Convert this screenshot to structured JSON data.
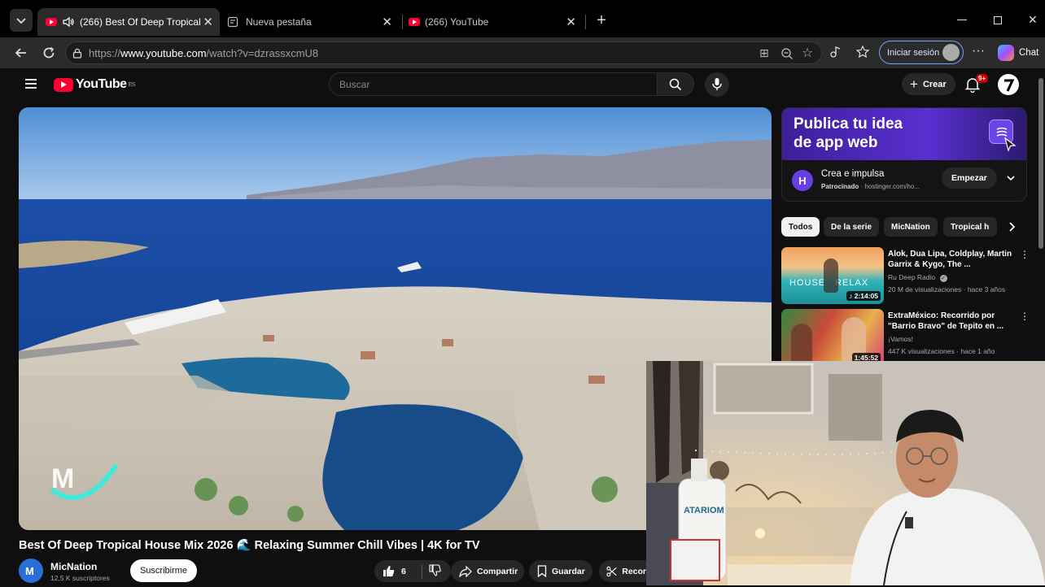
{
  "browser": {
    "tabs": [
      {
        "label": "(266) Best Of Deep Tropical H",
        "active": true
      },
      {
        "label": "Nueva pestaña",
        "active": false
      },
      {
        "label": "(266) YouTube",
        "active": false
      }
    ],
    "url_prefix": "https://",
    "url_host": "www.youtube.com",
    "url_path": "/watch?v=dzrassxcmU8",
    "signin_label": "Iniciar sesión",
    "chat_label": "Chat",
    "colors": {
      "tab_bar": "#000000",
      "toolbar": "#2b2b2b",
      "accent": "#7a9cff"
    }
  },
  "youtube": {
    "logo_text": "YouTube",
    "logo_region": "ES",
    "search_placeholder": "Buscar",
    "create_label": "Crear",
    "notifications_count": "9+",
    "colors": {
      "brand": "#ff0033",
      "background": "#0f0f0f"
    }
  },
  "video": {
    "title": "Best Of Deep Tropical House Mix 2026 🌊 Relaxing Summer Chill Vibes | 4K for TV",
    "channel_name": "MicNation",
    "subscribers": "12,5 K suscriptores",
    "subscribe_label": "Suscribirme",
    "likes": "6",
    "share_label": "Compartir",
    "save_label": "Guardar",
    "clip_label": "Recor"
  },
  "sidebar": {
    "ad": {
      "headline_line1": "Publica tu idea",
      "headline_line2": "de app web",
      "advertiser_initial": "H",
      "title": "Crea e impulsa",
      "sponsored_label": "Patrocinado",
      "domain": "hostinger.com/ho...",
      "cta_label": "Empezar"
    },
    "chips": [
      "Todos",
      "De la serie",
      "MicNation",
      "Tropical h"
    ],
    "recommendations": [
      {
        "title": "Alok, Dua Lipa, Coldplay, Martin Garrix & Kygo, The ...",
        "channel": "Ru Deep Radio",
        "views": "20 M de visualizaciones",
        "age": "hace 3 años",
        "duration": "2:14:05",
        "thumb_text_1": "HOUSE",
        "thumb_text_2": "RELAX"
      },
      {
        "title": "ExtraMéxico: Recorrido por \"Barrio Bravo\" de Tepito en ...",
        "channel": "¡Vamos!",
        "views": "447 K visualizaciones",
        "age": "hace 1 año",
        "duration": "1:45:52"
      }
    ]
  },
  "webcam": {
    "bottle_label": "ATARIOM"
  }
}
